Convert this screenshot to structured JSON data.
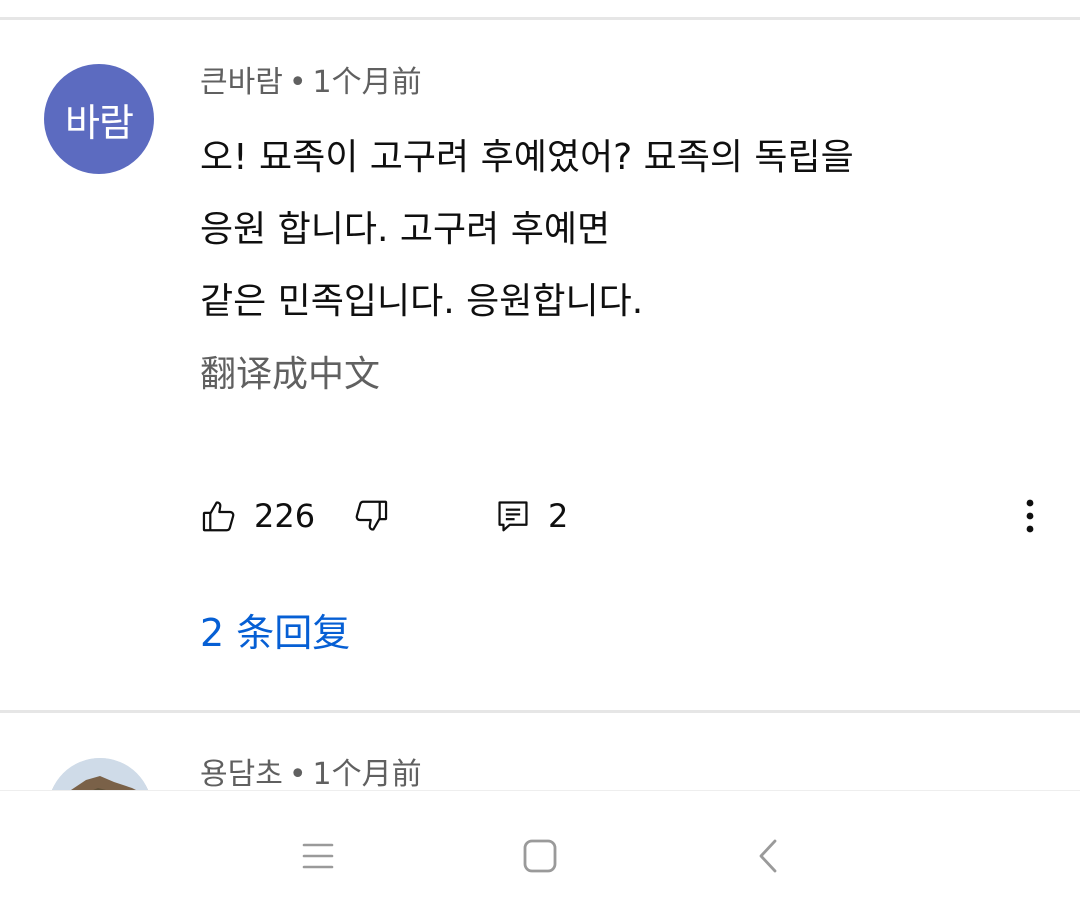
{
  "colors": {
    "avatar_bg": "#5c6bc0",
    "link": "#065fd4",
    "meta_text": "#606060",
    "divider": "#e6e6e6"
  },
  "comments": [
    {
      "avatar_text": "바람",
      "author": "큰바람",
      "separator": "•",
      "time": "1个月前",
      "text_lines": [
        "오! 묘족이 고구려 후예였어?  묘족의 독립을",
        "응원 합니다. 고구려 후예면",
        "같은 민족입니다. 응원합니다."
      ],
      "translate_label": "翻译成中文",
      "likes": "226",
      "reply_count": "2",
      "replies_link": "2 条回复",
      "icons": {
        "like": "thumbs-up-icon",
        "dislike": "thumbs-down-icon",
        "reply": "comment-icon",
        "more": "more-vertical-icon"
      }
    },
    {
      "author": "용담초",
      "separator": "•",
      "time": "1个月前"
    }
  ],
  "navbar": {
    "icons": [
      "menu-icon",
      "home-icon",
      "back-icon"
    ]
  }
}
